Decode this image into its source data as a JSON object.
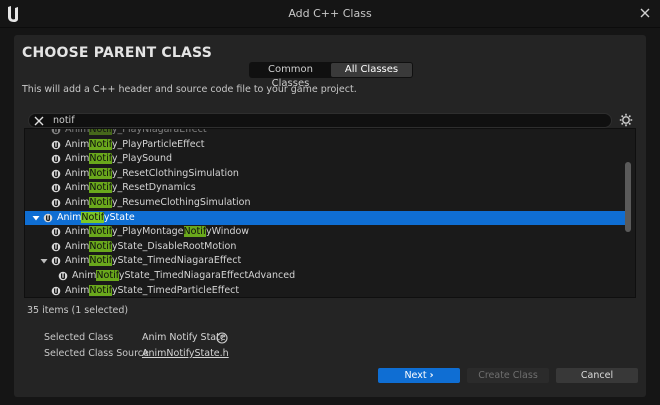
{
  "window": {
    "title": "Add C++ Class"
  },
  "heading": "CHOOSE PARENT CLASS",
  "toggle": {
    "options": [
      "Common Classes",
      "All Classes"
    ],
    "active": "All Classes"
  },
  "subtitle": "This will add a C++ header and source code file to your game project.",
  "search": {
    "value": "notif",
    "placeholder": ""
  },
  "class_tree": {
    "highlight": "Notif",
    "rows": [
      {
        "text": "AnimNotify_PlayNiagaraEffect",
        "depth": 1,
        "partial": true
      },
      {
        "text": "AnimNotify_PlayParticleEffect",
        "depth": 1
      },
      {
        "text": "AnimNotify_PlaySound",
        "depth": 1
      },
      {
        "text": "AnimNotify_ResetClothingSimulation",
        "depth": 1
      },
      {
        "text": "AnimNotify_ResetDynamics",
        "depth": 1
      },
      {
        "text": "AnimNotify_ResumeClothingSimulation",
        "depth": 1
      },
      {
        "text": "AnimNotifyState",
        "depth": 0,
        "expanded": true,
        "selected": true
      },
      {
        "text": "AnimNotify_PlayMontageNotifyWindow",
        "depth": 1
      },
      {
        "text": "AnimNotifyState_DisableRootMotion",
        "depth": 1
      },
      {
        "text": "AnimNotifyState_TimedNiagaraEffect",
        "depth": 1,
        "expanded": true
      },
      {
        "text": "AnimNotifyState_TimedNiagaraEffectAdvanced",
        "depth": 2
      },
      {
        "text": "AnimNotifyState_TimedParticleEffect",
        "depth": 1
      }
    ]
  },
  "count_text": "35 items (1 selected)",
  "selected_class": {
    "label": "Selected Class",
    "value": "Anim Notify State"
  },
  "selected_source": {
    "label": "Selected Class Source",
    "value": "AnimNotifyState.h"
  },
  "buttons": {
    "next": "Next",
    "create": "Create Class",
    "cancel": "Cancel"
  },
  "colors": {
    "accent": "#0f6ed3",
    "highlight": "#6aa81c"
  }
}
